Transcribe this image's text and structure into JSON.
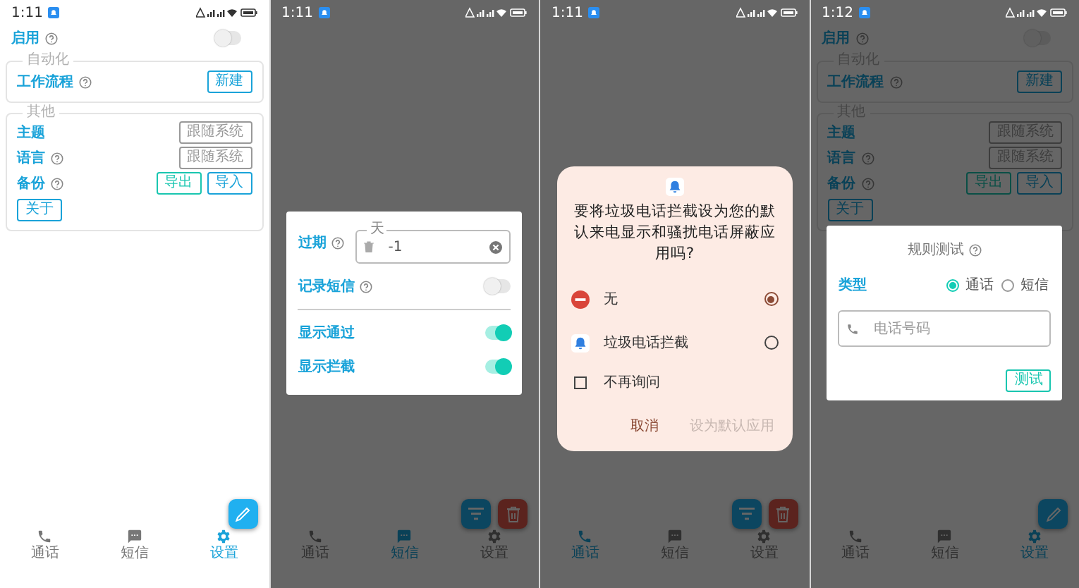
{
  "screens": [
    {
      "status_bar": {
        "time": "1:11"
      },
      "dimmed": false,
      "settings": {
        "enable": {
          "label": "启用",
          "help": true,
          "on": false
        },
        "groups": [
          {
            "title": "自动化",
            "rows": [
              {
                "label": "工作流程",
                "help": true,
                "buttons": [
                  "新建"
                ]
              }
            ]
          },
          {
            "title": "其他",
            "rows": [
              {
                "label": "主题",
                "help": false,
                "buttons": [
                  "跟随系统"
                ]
              },
              {
                "label": "语言",
                "help": true,
                "buttons": [
                  "跟随系统"
                ]
              },
              {
                "label": "备份",
                "help": true,
                "buttons": [
                  "导出",
                  "导入"
                ]
              }
            ],
            "footer_buttons": [
              "关于"
            ]
          }
        ]
      },
      "nav": [
        {
          "label": "通话",
          "selected": false
        },
        {
          "label": "短信",
          "selected": false
        },
        {
          "label": "设置",
          "selected": true
        }
      ]
    },
    {
      "status_bar": {
        "time": "1:11"
      },
      "dimmed": true,
      "dialog": {
        "kind": "sms_settings",
        "expiry": {
          "label": "过期",
          "help": true,
          "unit": "天",
          "value": "-1"
        },
        "toggles": [
          {
            "label": "记录短信",
            "help": true,
            "on": false,
            "divider_after": true
          },
          {
            "label": "显示通过",
            "help": false,
            "on": true
          },
          {
            "label": "显示拦截",
            "help": false,
            "on": true
          }
        ]
      },
      "nav": [
        {
          "label": "通话",
          "selected": false
        },
        {
          "label": "短信",
          "selected": true
        },
        {
          "label": "设置",
          "selected": false
        }
      ]
    },
    {
      "status_bar": {
        "time": "1:11"
      },
      "dimmed": true,
      "dialog": {
        "kind": "default_app",
        "title": "要将垃圾电话拦截设为您的默认来电显示和骚扰电话屏蔽应用吗?",
        "options": [
          {
            "kind": "none",
            "label": "无",
            "selected": true
          },
          {
            "kind": "app",
            "label": "垃圾电话拦截",
            "selected": false
          }
        ],
        "checkbox": {
          "label": "不再询问",
          "checked": false
        },
        "buttons": [
          {
            "label": "取消",
            "disabled": false
          },
          {
            "label": "设为默认应用",
            "disabled": true
          }
        ]
      },
      "nav": [
        {
          "label": "通话",
          "selected": true
        },
        {
          "label": "短信",
          "selected": false
        },
        {
          "label": "设置",
          "selected": false
        }
      ]
    },
    {
      "status_bar": {
        "time": "1:12"
      },
      "dimmed": true,
      "settings": {
        "enable": {
          "label": "启用",
          "help": true,
          "on": false
        },
        "groups": [
          {
            "title": "自动化",
            "rows": [
              {
                "label": "工作流程",
                "help": true,
                "buttons": [
                  "新建"
                ]
              }
            ]
          },
          {
            "title": "其他",
            "rows": [
              {
                "label": "主题",
                "help": false,
                "buttons": [
                  "跟随系统"
                ]
              },
              {
                "label": "语言",
                "help": true,
                "buttons": [
                  "跟随系统"
                ]
              },
              {
                "label": "备份",
                "help": true,
                "buttons": [
                  "导出",
                  "导入"
                ]
              }
            ],
            "footer_buttons": [
              "关于"
            ]
          }
        ]
      },
      "dialog": {
        "kind": "rule_test",
        "title": "规则测试",
        "help": true,
        "type_label": "类型",
        "types": [
          {
            "label": "通话",
            "selected": true
          },
          {
            "label": "短信",
            "selected": false
          }
        ],
        "phone_field": {
          "placeholder": "电话号码"
        },
        "button": "测试"
      },
      "nav": [
        {
          "label": "通话",
          "selected": false
        },
        {
          "label": "短信",
          "selected": false
        },
        {
          "label": "设置",
          "selected": true
        }
      ]
    }
  ]
}
